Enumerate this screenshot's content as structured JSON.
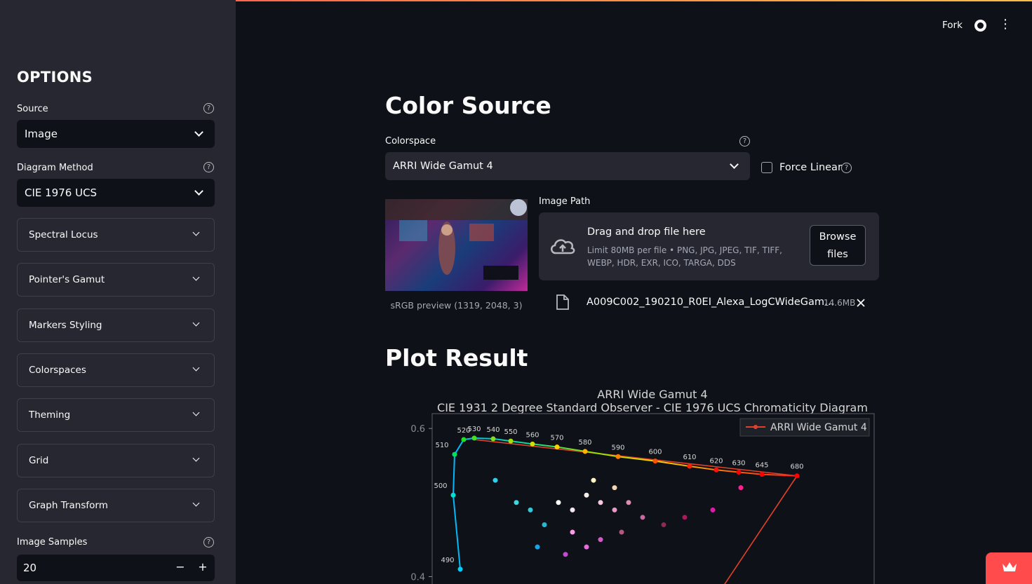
{
  "header": {
    "fork": "Fork",
    "github_icon": "github-icon",
    "menu_icon": "more-vert-icon"
  },
  "sidebar": {
    "title": "OPTIONS",
    "source_label": "Source",
    "source_value": "Image",
    "diagram_label": "Diagram Method",
    "diagram_value": "CIE 1976 UCS",
    "expanders": [
      "Spectral Locus",
      "Pointer's Gamut",
      "Markers Styling",
      "Colorspaces",
      "Theming",
      "Grid",
      "Graph Transform"
    ],
    "samples_label": "Image Samples",
    "samples_value": "20",
    "minus": "−",
    "plus": "+"
  },
  "main": {
    "heading": "Color Source",
    "colorspace_label": "Colorspace",
    "colorspace_value": "ARRI Wide Gamut 4",
    "force_linear": "Force Linear",
    "preview_caption": "sRGB preview (1319, 2048, 3)",
    "image_path_label": "Image Path",
    "drop_title": "Drag and drop file here",
    "drop_limits": "Limit 80MB per file • PNG, JPG, JPEG, TIF, TIFF, WEBP, HDR, EXR, ICO, TARGA, DDS",
    "browse_line1": "Browse",
    "browse_line2": "files",
    "file_name": "A009C002_190210_R0EI_Alexa_LogCWideGam…",
    "file_size": "14.6MB",
    "plot_heading": "Plot Result"
  },
  "chart_data": {
    "type": "scatter",
    "title": "ARRI Wide Gamut 4",
    "subtitle": "CIE 1931 2 Degree Standard Observer - CIE 1976 UCS Chromaticity Diagram",
    "legend": [
      "ARRI Wide Gamut 4"
    ],
    "legend_position": "top-right",
    "ylim": [
      0.39,
      0.62
    ],
    "xlim": [
      0.0,
      0.63
    ],
    "yticks": [
      0.4,
      0.6
    ],
    "locus_labels": [
      {
        "nm": "490",
        "u": 0.04,
        "v": 0.41
      },
      {
        "nm": "500",
        "u": 0.03,
        "v": 0.51
      },
      {
        "nm": "510",
        "u": 0.032,
        "v": 0.565
      },
      {
        "nm": "520",
        "u": 0.045,
        "v": 0.585
      },
      {
        "nm": "530",
        "u": 0.06,
        "v": 0.587
      },
      {
        "nm": "540",
        "u": 0.087,
        "v": 0.586
      },
      {
        "nm": "550",
        "u": 0.112,
        "v": 0.583
      },
      {
        "nm": "560",
        "u": 0.143,
        "v": 0.579
      },
      {
        "nm": "570",
        "u": 0.178,
        "v": 0.575
      },
      {
        "nm": "580",
        "u": 0.218,
        "v": 0.569
      },
      {
        "nm": "590",
        "u": 0.265,
        "v": 0.562
      },
      {
        "nm": "600",
        "u": 0.318,
        "v": 0.556
      },
      {
        "nm": "610",
        "u": 0.367,
        "v": 0.549
      },
      {
        "nm": "620",
        "u": 0.405,
        "v": 0.544
      },
      {
        "nm": "630",
        "u": 0.437,
        "v": 0.541
      },
      {
        "nm": "645",
        "u": 0.47,
        "v": 0.538
      },
      {
        "nm": "680",
        "u": 0.52,
        "v": 0.536
      }
    ],
    "gamut": [
      {
        "u": 0.06,
        "v": 0.585
      },
      {
        "u": 0.52,
        "v": 0.536
      },
      {
        "u": 0.41,
        "v": 0.38
      },
      {
        "u": 0.1,
        "v": 0.38
      }
    ],
    "samples": [
      {
        "u": 0.12,
        "v": 0.5,
        "c": "#3bd8e0"
      },
      {
        "u": 0.14,
        "v": 0.49,
        "c": "#33c9d6"
      },
      {
        "u": 0.16,
        "v": 0.47,
        "c": "#28b7d4"
      },
      {
        "u": 0.18,
        "v": 0.5,
        "c": "#ffffff"
      },
      {
        "u": 0.2,
        "v": 0.49,
        "c": "#f2e8f0"
      },
      {
        "u": 0.22,
        "v": 0.51,
        "c": "#f7eee8"
      },
      {
        "u": 0.24,
        "v": 0.5,
        "c": "#f8c9dd"
      },
      {
        "u": 0.26,
        "v": 0.49,
        "c": "#e89ac4"
      },
      {
        "u": 0.28,
        "v": 0.5,
        "c": "#e08bb5"
      },
      {
        "u": 0.3,
        "v": 0.48,
        "c": "#c76aa1"
      },
      {
        "u": 0.2,
        "v": 0.46,
        "c": "#ff9ae6"
      },
      {
        "u": 0.22,
        "v": 0.44,
        "c": "#e86cdc"
      },
      {
        "u": 0.24,
        "v": 0.45,
        "c": "#d45ac9"
      },
      {
        "u": 0.26,
        "v": 0.52,
        "c": "#f4d5b3"
      },
      {
        "u": 0.23,
        "v": 0.53,
        "c": "#fff6c8"
      },
      {
        "u": 0.33,
        "v": 0.47,
        "c": "#8a2b4f"
      },
      {
        "u": 0.36,
        "v": 0.48,
        "c": "#b0175d"
      },
      {
        "u": 0.4,
        "v": 0.49,
        "c": "#e01aa8"
      },
      {
        "u": 0.44,
        "v": 0.52,
        "c": "#ff1f8f"
      },
      {
        "u": 0.09,
        "v": 0.53,
        "c": "#2fd0ee"
      },
      {
        "u": 0.15,
        "v": 0.44,
        "c": "#16a6e8"
      },
      {
        "u": 0.19,
        "v": 0.43,
        "c": "#c44ad0"
      },
      {
        "u": 0.27,
        "v": 0.46,
        "c": "#b6577f"
      }
    ]
  }
}
